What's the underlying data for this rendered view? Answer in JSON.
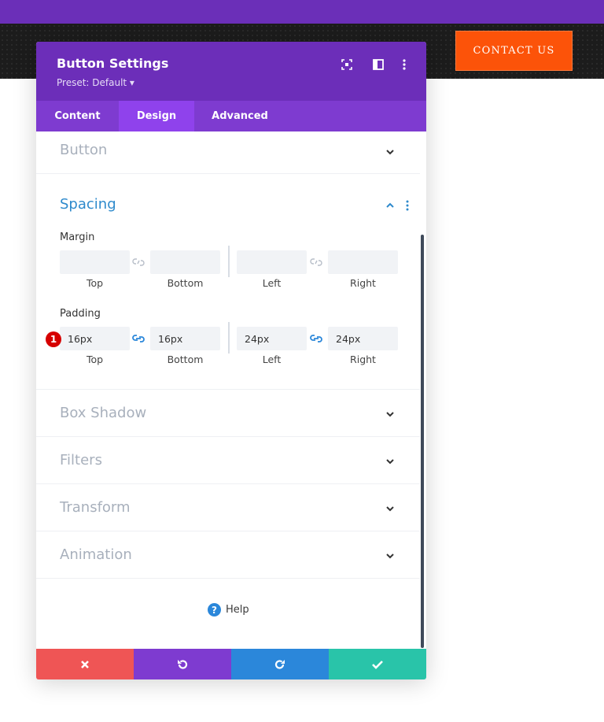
{
  "page": {
    "contact_label": "CONTACT US"
  },
  "modal": {
    "title": "Button Settings",
    "preset": "Preset: Default ▾",
    "header_icons": [
      "expand-icon",
      "split-layout-icon",
      "more-vertical-icon"
    ],
    "tabs": [
      {
        "label": "Content",
        "active": false
      },
      {
        "label": "Design",
        "active": true
      },
      {
        "label": "Advanced",
        "active": false
      }
    ]
  },
  "sections": {
    "button": {
      "title": "Button",
      "expanded": false
    },
    "spacing": {
      "title": "Spacing",
      "expanded": true,
      "margin": {
        "label": "Margin",
        "top": {
          "value": "",
          "label": "Top"
        },
        "bottom": {
          "value": "",
          "label": "Bottom"
        },
        "left": {
          "value": "",
          "label": "Left"
        },
        "right": {
          "value": "",
          "label": "Right"
        },
        "linked_vertical": false,
        "linked_horizontal": false
      },
      "padding": {
        "label": "Padding",
        "top": {
          "value": "16px",
          "label": "Top"
        },
        "bottom": {
          "value": "16px",
          "label": "Bottom"
        },
        "left": {
          "value": "24px",
          "label": "Left"
        },
        "right": {
          "value": "24px",
          "label": "Right"
        },
        "linked_vertical": true,
        "linked_horizontal": true
      }
    },
    "box_shadow": {
      "title": "Box Shadow",
      "expanded": false
    },
    "filters": {
      "title": "Filters",
      "expanded": false
    },
    "transform": {
      "title": "Transform",
      "expanded": false
    },
    "animation": {
      "title": "Animation",
      "expanded": false
    }
  },
  "annotation_badge": "1",
  "help": {
    "label": "Help",
    "icon": "question-circle-icon"
  },
  "footer": {
    "buttons": [
      {
        "name": "discard",
        "icon": "x-icon",
        "color": "#ef5555"
      },
      {
        "name": "undo",
        "icon": "undo-icon",
        "color": "#7e3bd0"
      },
      {
        "name": "redo",
        "icon": "redo-icon",
        "color": "#2b87da"
      },
      {
        "name": "save",
        "icon": "check-icon",
        "color": "#29c4a9"
      }
    ]
  },
  "colors": {
    "top_bar": "#6b2fb8",
    "modal_header": "#6c2eb9",
    "tabs_bar": "#7e3bd0",
    "active_tab": "#8f42ec",
    "contact_button": "#fc5309",
    "section_expanded_title": "#2e8acc",
    "link_active": "#2b87da"
  }
}
